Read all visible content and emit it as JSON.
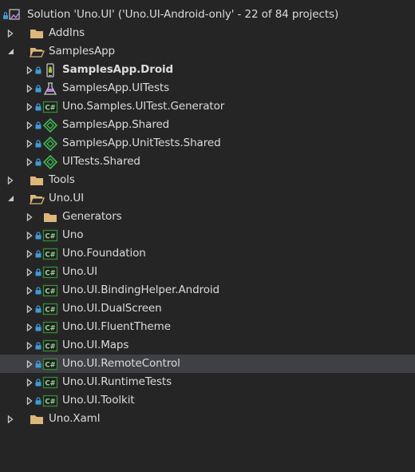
{
  "solution": {
    "label": "Solution 'Uno.UI' ('Uno.UI-Android-only' - 22 of 84 projects)",
    "icon": "solution-icon"
  },
  "items": [
    {
      "label": "AddIns",
      "icon": "folder",
      "depth": 0,
      "expanded": false,
      "lock": false
    },
    {
      "label": "SamplesApp",
      "icon": "folder-open",
      "depth": 0,
      "expanded": true,
      "lock": false
    },
    {
      "label": "SamplesApp.Droid",
      "icon": "android-project",
      "depth": 1,
      "expanded": false,
      "lock": true,
      "bold": true
    },
    {
      "label": "SamplesApp.UITests",
      "icon": "test-project",
      "depth": 1,
      "expanded": false,
      "lock": true
    },
    {
      "label": "Uno.Samples.UITest.Generator",
      "icon": "csharp-project",
      "depth": 1,
      "expanded": false,
      "lock": true
    },
    {
      "label": "SamplesApp.Shared",
      "icon": "shared-project",
      "depth": 1,
      "expanded": false,
      "lock": true
    },
    {
      "label": "SamplesApp.UnitTests.Shared",
      "icon": "shared-project",
      "depth": 1,
      "expanded": false,
      "lock": true
    },
    {
      "label": "UITests.Shared",
      "icon": "shared-project",
      "depth": 1,
      "expanded": false,
      "lock": true
    },
    {
      "label": "Tools",
      "icon": "folder",
      "depth": 0,
      "expanded": false,
      "lock": false
    },
    {
      "label": "Uno.UI",
      "icon": "folder-open",
      "depth": 0,
      "expanded": true,
      "lock": false
    },
    {
      "label": "Generators",
      "icon": "folder",
      "depth": 1,
      "expanded": false,
      "lock": false
    },
    {
      "label": "Uno",
      "icon": "csharp-project",
      "depth": 1,
      "expanded": false,
      "lock": true
    },
    {
      "label": "Uno.Foundation",
      "icon": "csharp-project",
      "depth": 1,
      "expanded": false,
      "lock": true
    },
    {
      "label": "Uno.UI",
      "icon": "csharp-project",
      "depth": 1,
      "expanded": false,
      "lock": true
    },
    {
      "label": "Uno.UI.BindingHelper.Android",
      "icon": "csharp-project",
      "depth": 1,
      "expanded": false,
      "lock": true
    },
    {
      "label": "Uno.UI.DualScreen",
      "icon": "csharp-project",
      "depth": 1,
      "expanded": false,
      "lock": true
    },
    {
      "label": "Uno.UI.FluentTheme",
      "icon": "csharp-project",
      "depth": 1,
      "expanded": false,
      "lock": true
    },
    {
      "label": "Uno.UI.Maps",
      "icon": "csharp-project",
      "depth": 1,
      "expanded": false,
      "lock": true
    },
    {
      "label": "Uno.UI.RemoteControl",
      "icon": "csharp-project",
      "depth": 1,
      "expanded": false,
      "lock": true,
      "highlighted": true
    },
    {
      "label": "Uno.UI.RuntimeTests",
      "icon": "csharp-project",
      "depth": 1,
      "expanded": false,
      "lock": true
    },
    {
      "label": "Uno.UI.Toolkit",
      "icon": "csharp-project",
      "depth": 1,
      "expanded": false,
      "lock": true
    },
    {
      "label": "Uno.Xaml",
      "icon": "folder",
      "depth": 0,
      "expanded": false,
      "lock": false
    }
  ],
  "colors": {
    "background": "#252526",
    "highlight": "#3f3f46",
    "text": "#dcdcdc",
    "folder": "#dcb67a",
    "csharp": "#368832",
    "shared": "#3fb950",
    "lock": "#3e9cd8"
  }
}
